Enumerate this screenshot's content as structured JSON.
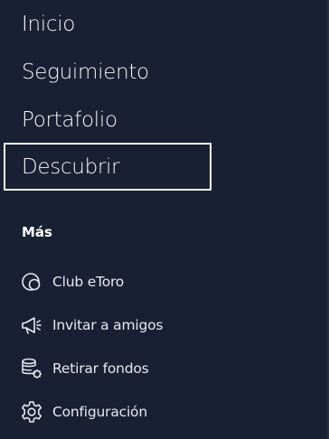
{
  "main_nav": {
    "items": [
      {
        "label": "Inicio"
      },
      {
        "label": "Seguimiento"
      },
      {
        "label": "Portafolio"
      },
      {
        "label": "Descubrir",
        "focused": true
      }
    ]
  },
  "more_section": {
    "title": "Más",
    "items": [
      {
        "label": "Club eToro",
        "icon": "club-icon"
      },
      {
        "label": "Invitar a amigos",
        "icon": "megaphone-icon"
      },
      {
        "label": "Retirar fondos",
        "icon": "withdraw-icon"
      },
      {
        "label": "Configuración",
        "icon": "gear-icon"
      }
    ]
  },
  "colors": {
    "background": "#1a2033",
    "text": "#ffffff",
    "focus_ring": "#ffffff"
  }
}
